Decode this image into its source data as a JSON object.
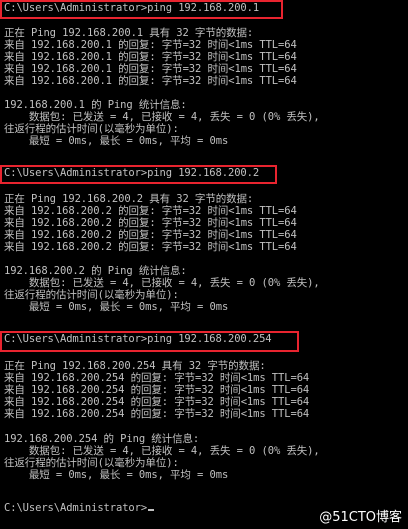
{
  "console": {
    "lines": [
      "C:\\Users\\Administrator>ping 192.168.200.1",
      "",
      "正在 Ping 192.168.200.1 具有 32 字节的数据:",
      "来自 192.168.200.1 的回复: 字节=32 时间<1ms TTL=64",
      "来自 192.168.200.1 的回复: 字节=32 时间<1ms TTL=64",
      "来自 192.168.200.1 的回复: 字节=32 时间<1ms TTL=64",
      "来自 192.168.200.1 的回复: 字节=32 时间<1ms TTL=64",
      "",
      "192.168.200.1 的 Ping 统计信息:",
      "    数据包: 已发送 = 4, 已接收 = 4, 丢失 = 0 (0% 丢失),",
      "往返行程的估计时间(以毫秒为单位):",
      "    最短 = 0ms, 最长 = 0ms, 平均 = 0ms",
      "",
      "C:\\Users\\Administrator>ping 192.168.200.2",
      "",
      "正在 Ping 192.168.200.2 具有 32 字节的数据:",
      "来自 192.168.200.2 的回复: 字节=32 时间<1ms TTL=64",
      "来自 192.168.200.2 的回复: 字节=32 时间<1ms TTL=64",
      "来自 192.168.200.2 的回复: 字节=32 时间<1ms TTL=64",
      "来自 192.168.200.2 的回复: 字节=32 时间<1ms TTL=64",
      "",
      "192.168.200.2 的 Ping 统计信息:",
      "    数据包: 已发送 = 4, 已接收 = 4, 丢失 = 0 (0% 丢失),",
      "往返行程的估计时间(以毫秒为单位):",
      "    最短 = 0ms, 最长 = 0ms, 平均 = 0ms",
      "",
      "C:\\Users\\Administrator>ping 192.168.200.254",
      "",
      "正在 Ping 192.168.200.254 具有 32 字节的数据:",
      "来自 192.168.200.254 的回复: 字节=32 时间<1ms TTL=64",
      "来自 192.168.200.254 的回复: 字节=32 时间<1ms TTL=64",
      "来自 192.168.200.254 的回复: 字节=32 时间<1ms TTL=64",
      "来自 192.168.200.254 的回复: 字节=32 时间<1ms TTL=64",
      "",
      "192.168.200.254 的 Ping 统计信息:",
      "    数据包: 已发送 = 4, 已接收 = 4, 丢失 = 0 (0% 丢失),",
      "往返行程的估计时间(以毫秒为单位):",
      "    最短 = 0ms, 最长 = 0ms, 平均 = 0ms",
      "",
      "C:\\Users\\Administrator>"
    ]
  },
  "watermark": "@51CTO博客",
  "colors": {
    "background": "#000000",
    "text": "#c0c0c0",
    "highlight_border": "#e8242f"
  }
}
